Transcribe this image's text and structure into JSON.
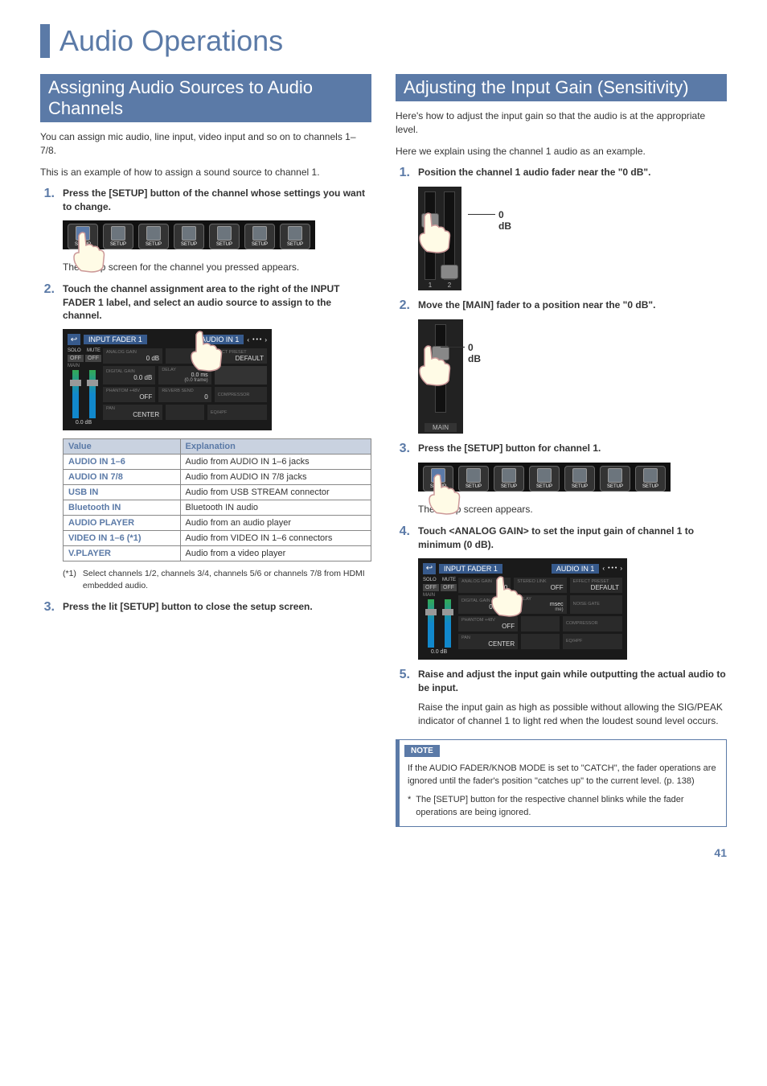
{
  "page_title": "Audio Operations",
  "page_number": "41",
  "left": {
    "heading": "Assigning Audio Sources to Audio Channels",
    "intro1": "You can assign mic audio, line input, video input and so on to channels 1–7/8.",
    "intro2": "This is an example of how to assign a sound source to channel 1.",
    "step1_num": "1.",
    "step1_text": "Press the [SETUP] button of the channel whose settings you want to change.",
    "step1_sub": "The setup screen for the channel you pressed appears.",
    "step2_num": "2.",
    "step2_text": "Touch the channel assignment area to the right of the INPUT FADER 1 label, and select an audio source to assign to the channel.",
    "table_head_value": "Value",
    "table_head_expl": "Explanation",
    "rows": [
      {
        "v": "AUDIO IN 1–6",
        "e": "Audio from AUDIO IN 1–6 jacks"
      },
      {
        "v": "AUDIO IN 7/8",
        "e": "Audio from AUDIO IN 7/8 jacks"
      },
      {
        "v": "USB IN",
        "e": "Audio from USB STREAM connector"
      },
      {
        "v": "Bluetooth IN",
        "e": "Bluetooth IN audio"
      },
      {
        "v": "AUDIO PLAYER",
        "e": "Audio from an audio player"
      },
      {
        "v": "VIDEO IN 1–6 (*1)",
        "e": "Audio from VIDEO IN 1–6 connectors"
      },
      {
        "v": "V.PLAYER",
        "e": "Audio from a video player"
      }
    ],
    "footnote_mark": "(*1)",
    "footnote_text": "Select channels 1/2, channels 3/4, channels 5/6 or channels 7/8 from HDMI embedded audio.",
    "step3_num": "3.",
    "step3_text": "Press the lit [SETUP] button to close the setup screen.",
    "lcd": {
      "title": "INPUT FADER 1",
      "src": "AUDIO IN 1",
      "solo": "SOLO",
      "mute": "MUTE",
      "analog_gain": "ANALOG GAIN",
      "effect_preset": "EFFECT PRESET",
      "off": "OFF",
      "zero_db": "0 dB",
      "default": "DEFAULT",
      "main": "MAIN",
      "digital_gain": "DIGITAL GAIN",
      "delay": "DELAY",
      "dg_val": "0.0 dB",
      "delay_val1": "0.0 ms",
      "delay_val2": "(0.0 frame)",
      "phantom": "PHANTOM +48V",
      "reverb": "REVERB SEND",
      "compressor": "COMPRESSOR",
      "rev_val": "0",
      "pan": "PAN",
      "center": "CENTER",
      "eqhpf": "EQ/HPF",
      "fader_db": "0.0 dB"
    }
  },
  "right": {
    "heading": "Adjusting the Input Gain (Sensitivity)",
    "intro1": "Here's how to adjust the input gain so that the audio is at the appropriate level.",
    "intro2": "Here we explain using the channel 1 audio as an example.",
    "step1_num": "1.",
    "step1_text": "Position the channel 1 audio fader near the \"0 dB\".",
    "zero_db": "0 dB",
    "fader1_label": "1",
    "fader2_label": "2",
    "step2_num": "2.",
    "step2_text": "Move the [MAIN] fader to a position near the \"0 dB\".",
    "main_label": "MAIN",
    "step3_num": "3.",
    "step3_text": "Press the [SETUP] button for channel 1.",
    "step3_sub": "The setup screen appears.",
    "step4_num": "4.",
    "step4_text": "Touch <ANALOG GAIN> to set the input gain of channel 1 to minimum (0 dB).",
    "step5_num": "5.",
    "step5_text": "Raise and adjust the input gain while outputting the actual audio to be input.",
    "step5_sub": "Raise the input gain as high as possible without allowing the SIG/PEAK indicator of channel 1 to light red when the loudest sound level occurs.",
    "note_label": "NOTE",
    "note_body": "If the AUDIO FADER/KNOB MODE is set to \"CATCH\", the fader operations are ignored until the fader's position \"catches up\" to the current level. (p. 138)",
    "note_ast_mark": "*",
    "note_ast": "The [SETUP] button for the respective channel blinks while the fader operations are being ignored.",
    "lcd": {
      "title": "INPUT FADER 1",
      "src": "AUDIO IN 1",
      "solo": "SOLO",
      "mute": "MUTE",
      "analog_gain": "ANALOG GAIN",
      "stereo_link": "STEREO LINK",
      "effect_preset": "EFFECT PRESET",
      "off": "OFF",
      "zero": "0",
      "default": "DEFAULT",
      "main": "MAIN",
      "digital_gain": "DIGITAL GAIN",
      "delay": "DELAY",
      "noise_gate": "NOISE GATE",
      "dg_val": "0.0 dB",
      "msec": "msec",
      "me": "me)",
      "compressor": "COMPRESSOR",
      "phantom": "PHANTOM +48V",
      "pan": "PAN",
      "center": "CENTER",
      "eqhpf": "EQ/HPF",
      "fader_db": "0.0 dB"
    }
  },
  "setup_label": "SETUP"
}
